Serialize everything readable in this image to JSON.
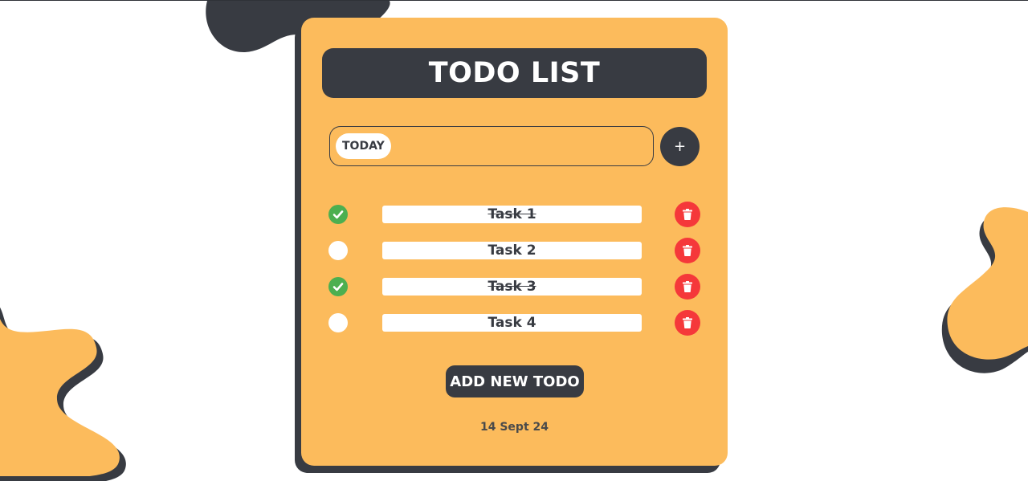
{
  "header": {
    "title": "TODO LIST"
  },
  "input": {
    "chip_label": "TODAY",
    "add_symbol": "+"
  },
  "todos": [
    {
      "label": "Task 1",
      "done": true
    },
    {
      "label": "Task 2",
      "done": false
    },
    {
      "label": "Task 3",
      "done": true
    },
    {
      "label": "Task 4",
      "done": false
    }
  ],
  "actions": {
    "add_new_label": "ADD NEW TODO"
  },
  "footer": {
    "date": "14 Sept 24"
  },
  "colors": {
    "card": "#fcbb5c",
    "dark": "#383b42",
    "done": "#4caf50",
    "delete": "#f5383a",
    "blob_orange": "#fcbb5c",
    "blob_dark": "#383b42"
  },
  "icons": {
    "check": "check-icon",
    "delete": "trash-icon",
    "add": "plus-icon"
  }
}
